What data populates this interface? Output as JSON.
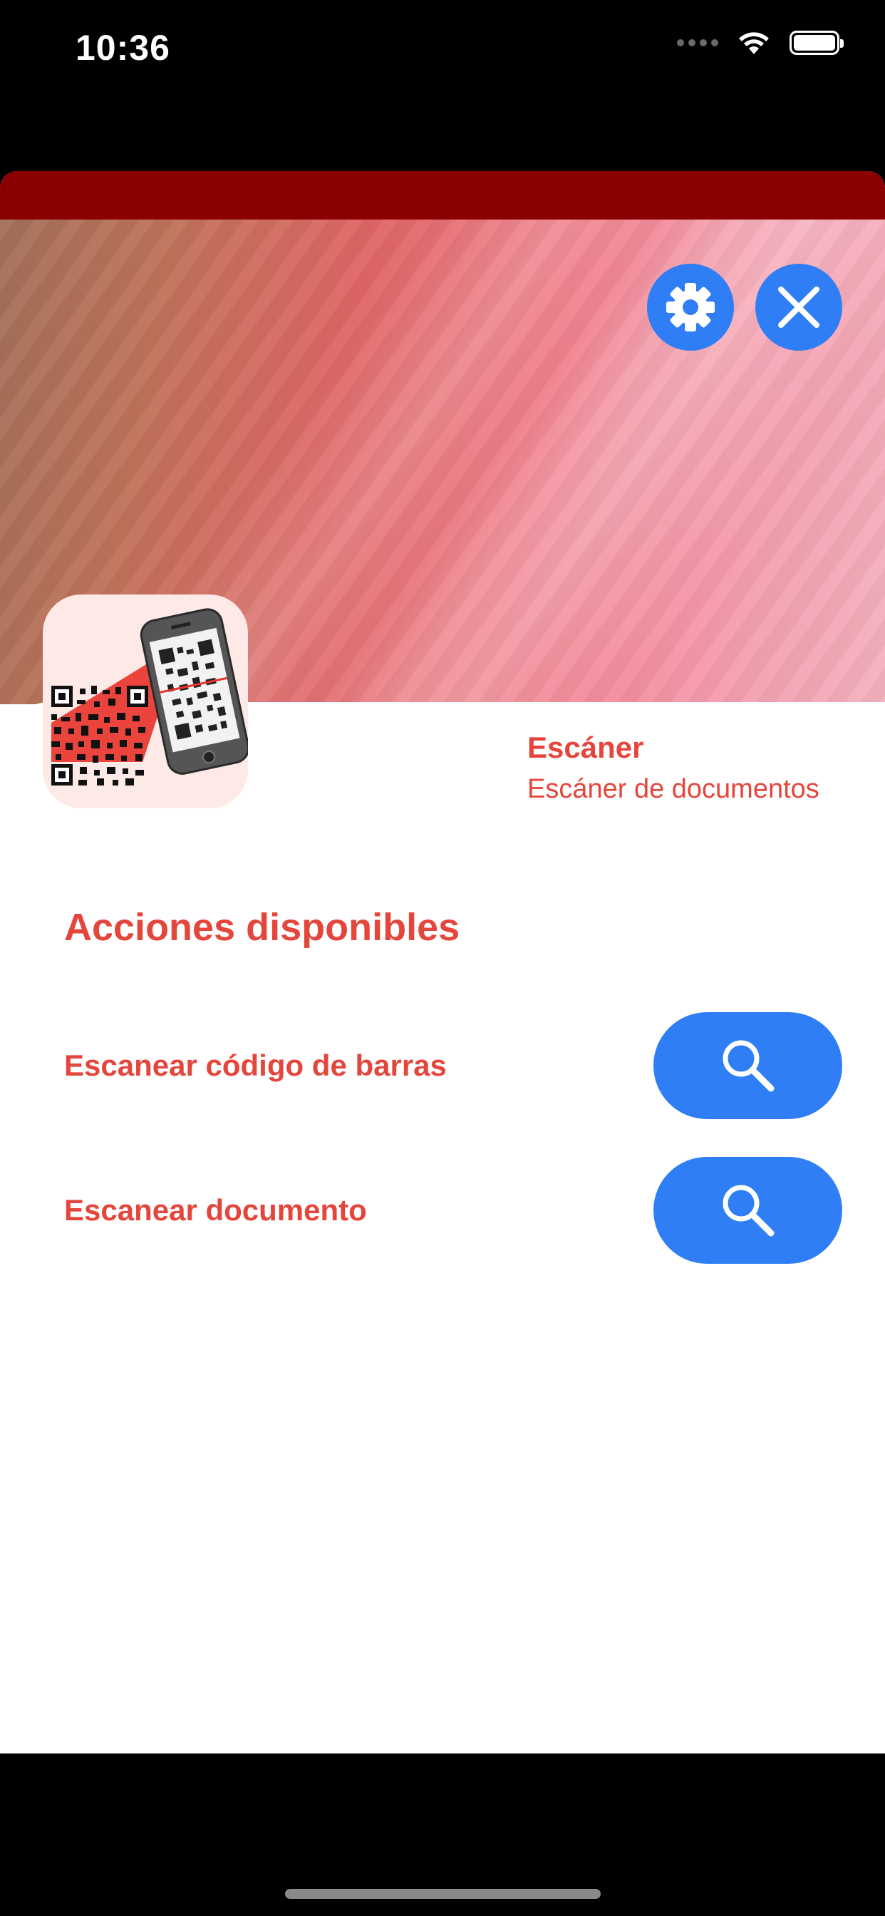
{
  "status_bar": {
    "time": "10:36",
    "icons": [
      "cellular-dots-icon",
      "wifi-icon",
      "battery-icon"
    ]
  },
  "header": {
    "settings_icon": "gear-icon",
    "close_icon": "close-icon"
  },
  "app": {
    "name": "Escáner",
    "subtitle": "Escáner de documentos",
    "icon": "qr-scanner-phone-icon"
  },
  "actions": {
    "title": "Acciones disponibles",
    "items": [
      {
        "label": "Escanear código de barras",
        "button_icon": "search-icon"
      },
      {
        "label": "Escanear documento",
        "button_icon": "search-icon"
      }
    ]
  },
  "colors": {
    "accent_red": "#e4463c",
    "header_dark_red": "#8b0000",
    "button_blue": "#2f7ef5"
  }
}
